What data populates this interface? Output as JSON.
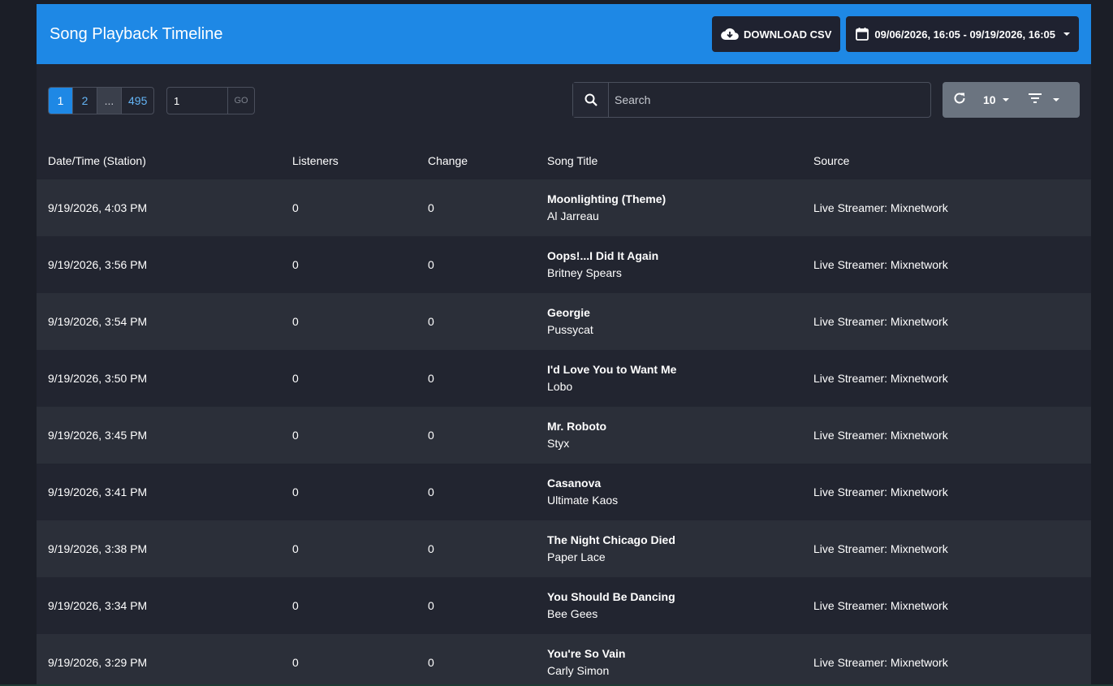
{
  "header": {
    "title": "Song Playback Timeline",
    "download_label": "DOWNLOAD CSV",
    "date_range": "09/06/2026, 16:05 - 09/19/2026, 16:05"
  },
  "pagination": {
    "pages": [
      "1",
      "2",
      "...",
      "495"
    ],
    "goto_value": "1",
    "go_label": "GO"
  },
  "search": {
    "placeholder": "Search"
  },
  "tools": {
    "per_page": "10"
  },
  "table": {
    "columns": [
      "Date/Time (Station)",
      "Listeners",
      "Change",
      "Song Title",
      "Source"
    ],
    "rows": [
      {
        "datetime": "9/19/2026, 4:03 PM",
        "listeners": "0",
        "change": "0",
        "title": "Moonlighting (Theme)",
        "artist": "Al Jarreau",
        "source": "Live Streamer: Mixnetwork"
      },
      {
        "datetime": "9/19/2026, 3:56 PM",
        "listeners": "0",
        "change": "0",
        "title": "Oops!...I Did It Again",
        "artist": "Britney Spears",
        "source": "Live Streamer: Mixnetwork"
      },
      {
        "datetime": "9/19/2026, 3:54 PM",
        "listeners": "0",
        "change": "0",
        "title": "Georgie",
        "artist": "Pussycat",
        "source": "Live Streamer: Mixnetwork"
      },
      {
        "datetime": "9/19/2026, 3:50 PM",
        "listeners": "0",
        "change": "0",
        "title": "I'd Love You to Want Me",
        "artist": "Lobo",
        "source": "Live Streamer: Mixnetwork"
      },
      {
        "datetime": "9/19/2026, 3:45 PM",
        "listeners": "0",
        "change": "0",
        "title": "Mr. Roboto",
        "artist": "Styx",
        "source": "Live Streamer: Mixnetwork"
      },
      {
        "datetime": "9/19/2026, 3:41 PM",
        "listeners": "0",
        "change": "0",
        "title": "Casanova",
        "artist": "Ultimate Kaos",
        "source": "Live Streamer: Mixnetwork"
      },
      {
        "datetime": "9/19/2026, 3:38 PM",
        "listeners": "0",
        "change": "0",
        "title": "The Night Chicago Died",
        "artist": "Paper Lace",
        "source": "Live Streamer: Mixnetwork"
      },
      {
        "datetime": "9/19/2026, 3:34 PM",
        "listeners": "0",
        "change": "0",
        "title": "You Should Be Dancing",
        "artist": "Bee Gees",
        "source": "Live Streamer: Mixnetwork"
      },
      {
        "datetime": "9/19/2026, 3:29 PM",
        "listeners": "0",
        "change": "0",
        "title": "You're So Vain",
        "artist": "Carly Simon",
        "source": "Live Streamer: Mixnetwork"
      }
    ]
  },
  "colors": {
    "accent": "#1e88e5",
    "background": "#1b1e27",
    "card": "#222530",
    "row_alt": "#2b2f39"
  }
}
